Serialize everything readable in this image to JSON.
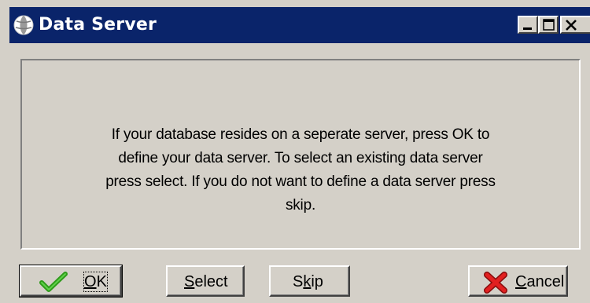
{
  "window": {
    "title": "Data Server",
    "icon": "globe-icon",
    "controls": [
      "minimize-icon",
      "maximize-icon",
      "close-icon"
    ]
  },
  "message": {
    "lines": [
      "If your database resides on a seperate server, press OK to",
      "define your data server. To select an existing data server",
      "press select. If you do not want to define a data server press",
      "skip."
    ]
  },
  "buttons": {
    "ok": {
      "label": "OK",
      "icon": "checkmark-icon",
      "accent": "#2e9a1a"
    },
    "select": {
      "label": "Select"
    },
    "skip": {
      "label": "Skip"
    },
    "cancel": {
      "label": "Cancel",
      "icon": "red-x-icon",
      "accent": "#d81818"
    }
  },
  "colors": {
    "titlebar": "#0a246a",
    "face": "#d4d0c8"
  }
}
